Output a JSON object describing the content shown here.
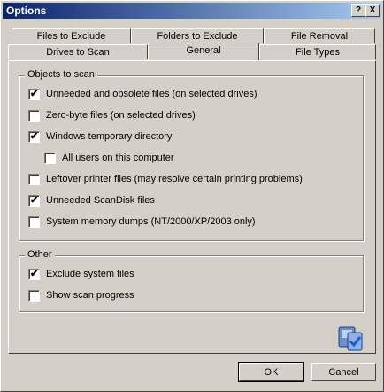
{
  "window": {
    "title": "Options",
    "help_label": "?",
    "close_label": "X"
  },
  "tabs_row1": [
    "Files to Exclude",
    "Folders to Exclude",
    "File Removal"
  ],
  "tabs_row2": [
    "Drives to Scan",
    "General",
    "File Types"
  ],
  "active_tab": "General",
  "objects_group": {
    "label": "Objects to scan",
    "items": [
      {
        "label": "Unneeded and obsolete files (on selected drives)",
        "checked": true
      },
      {
        "label": "Zero-byte files (on selected drives)",
        "checked": false
      },
      {
        "label": "Windows temporary directory",
        "checked": true
      },
      {
        "label": "All users on this computer",
        "checked": false
      },
      {
        "label": "Leftover printer files (may resolve certain printing problems)",
        "checked": false
      },
      {
        "label": "Unneeded ScanDisk files",
        "checked": true
      },
      {
        "label": "System memory dumps (NT/2000/XP/2003 only)",
        "checked": false
      }
    ]
  },
  "other_group": {
    "label": "Other",
    "items": [
      {
        "label": "Exclude system files",
        "checked": true
      },
      {
        "label": "Show scan progress",
        "checked": false
      }
    ]
  },
  "buttons": {
    "ok": "OK",
    "cancel": "Cancel"
  },
  "check_glyph": "✔",
  "colors": {
    "title_start": "#0a246a",
    "title_end": "#a6caf0",
    "face": "#d4d0c8"
  },
  "icons": {
    "app": "computer-check-icon"
  }
}
